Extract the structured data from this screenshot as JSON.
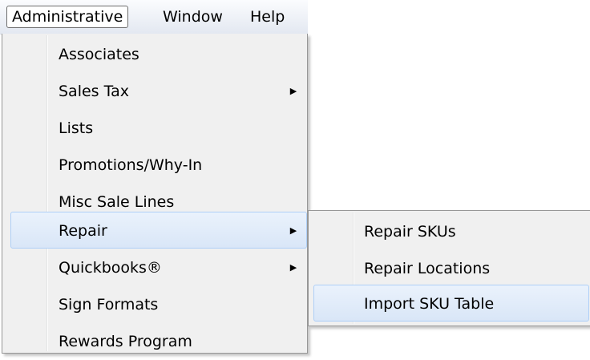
{
  "menubar": {
    "items": [
      {
        "label": "Administrative"
      },
      {
        "label": "Window"
      },
      {
        "label": "Help"
      }
    ]
  },
  "admin_menu": {
    "items": [
      {
        "label": "Associates"
      },
      {
        "label": "Sales Tax",
        "arrow": "▶"
      },
      {
        "label": "Lists"
      },
      {
        "label": "Promotions/Why-In"
      },
      {
        "label": "Misc Sale Lines"
      },
      {
        "label": "Repair",
        "arrow": "▶"
      },
      {
        "label": "Quickbooks®",
        "arrow": "▶"
      },
      {
        "label": "Sign Formats"
      },
      {
        "label": "Rewards Program"
      }
    ]
  },
  "repair_submenu": {
    "items": [
      {
        "label": "Repair SKUs"
      },
      {
        "label": "Repair Locations"
      },
      {
        "label": "Import SKU Table"
      }
    ]
  }
}
